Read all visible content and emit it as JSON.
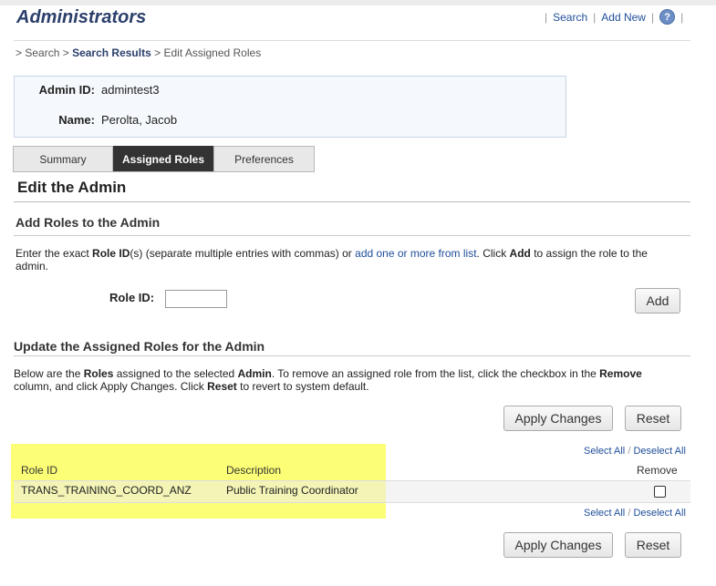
{
  "header": {
    "title": "Administrators",
    "links": [
      "Search",
      "Add New"
    ],
    "help_glyph": "?"
  },
  "breadcrumb": {
    "items": [
      "Search",
      "Search Results",
      "Edit Assigned Roles"
    ]
  },
  "admin_info": {
    "id_label": "Admin ID:",
    "id_value": "admintest3",
    "name_label": "Name:",
    "name_value": "Perolta, Jacob"
  },
  "tabs": [
    "Summary",
    "Assigned Roles",
    "Preferences"
  ],
  "page_heading": "Edit the Admin",
  "add_section": {
    "heading": "Add Roles to the Admin",
    "text1": "Enter the exact ",
    "bold1": "Role ID",
    "text2": "(s) (separate multiple entries with commas) or ",
    "link": "add one or more from list",
    "text3": ". Click ",
    "bold2": "Add",
    "text4": " to assign the role to the",
    "line2": "admin.",
    "role_id_label": "Role ID:",
    "role_id_value": "",
    "add_button": "Add"
  },
  "update_section": {
    "heading": "Update the Assigned Roles for the Admin",
    "text1": "Below are the ",
    "bold1": "Roles",
    "text2": " assigned to the selected ",
    "bold2": "Admin",
    "text3": ". To remove an assigned role from the list, click the checkbox in the ",
    "bold3": "Remove",
    "line2a": "column, and click Apply Changes. Click ",
    "bold4": "Reset",
    "line2b": " to revert to system default.",
    "apply_button": "Apply Changes",
    "reset_button": "Reset",
    "select_all": "Select All",
    "deselect_all": "Deselect All",
    "separator": "/"
  },
  "table": {
    "columns": [
      "Role ID",
      "Description",
      "Remove"
    ],
    "rows": [
      {
        "role_id": "TRANS_TRAINING_COORD_ANZ",
        "description": "Public Training Coordinator",
        "remove": false
      }
    ]
  },
  "colors": {
    "title": "#2b3f6b",
    "link": "#1f4e9a",
    "highlight": "#fbff5e",
    "active_tab": "#333333"
  }
}
